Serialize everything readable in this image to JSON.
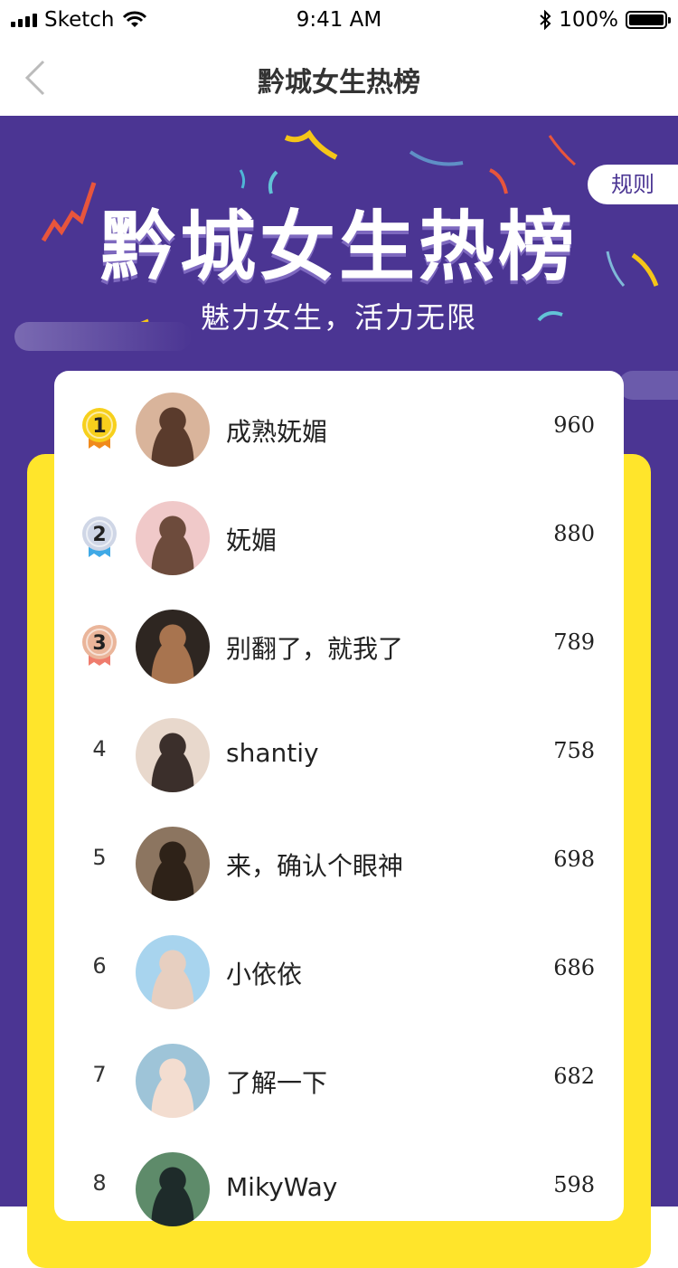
{
  "status_bar": {
    "carrier": "Sketch",
    "time": "9:41 AM",
    "battery": "100%",
    "battery_level": 1.0
  },
  "nav": {
    "title": "黔城女生热榜"
  },
  "banner": {
    "title": "黔城女生热榜",
    "subtitle": "魅力女生，活力无限",
    "rules_label": "规则"
  },
  "colors": {
    "banner_bg": "#4b3593",
    "frame_yellow": "#ffe52b",
    "medal_gold": "#f7d01c",
    "medal_silver": "#cfd6e6",
    "medal_bronze": "#eab59a"
  },
  "ranking": [
    {
      "rank": "1",
      "name": "成熟妩媚",
      "score": "960",
      "medal": "gold"
    },
    {
      "rank": "2",
      "name": "妩媚",
      "score": "880",
      "medal": "silver"
    },
    {
      "rank": "3",
      "name": "别翻了，就我了",
      "score": "789",
      "medal": "bronze"
    },
    {
      "rank": "4",
      "name": "shantiy",
      "score": "758",
      "medal": ""
    },
    {
      "rank": "5",
      "name": "来，确认个眼神",
      "score": "698",
      "medal": ""
    },
    {
      "rank": "6",
      "name": "小依依",
      "score": "686",
      "medal": ""
    },
    {
      "rank": "7",
      "name": "了解一下",
      "score": "682",
      "medal": ""
    },
    {
      "rank": "8",
      "name": "MikyWay",
      "score": "598",
      "medal": ""
    }
  ]
}
